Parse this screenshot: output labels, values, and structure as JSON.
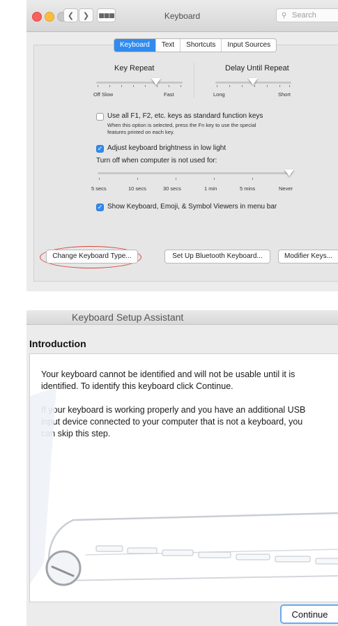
{
  "keyboard_window": {
    "title": "Keyboard",
    "search_placeholder": "Search",
    "tabs": [
      "Keyboard",
      "Text",
      "Shortcuts",
      "Input Sources"
    ],
    "active_tab": "Keyboard",
    "key_repeat": {
      "label": "Key Repeat",
      "min_label": "Off Slow",
      "max_label": "Fast",
      "level": 0.72
    },
    "delay_until_repeat": {
      "label": "Delay Until Repeat",
      "min_label": "Long",
      "max_label": "Short",
      "level": 0.5
    },
    "function_keys": {
      "label": "Use all F1, F2, etc. keys as standard function keys",
      "checked": false,
      "note_line1": "When this option is selected, press the Fn key to use the special",
      "note_line2": "features printed on each key."
    },
    "brightness": {
      "label": "Adjust keyboard brightness in low light",
      "checked": true
    },
    "turn_off": {
      "label": "Turn off when computer is not used for:",
      "ticks": [
        "5 secs",
        "10 secs",
        "30 secs",
        "1 min",
        "5 mins",
        "Never"
      ],
      "selected": "Never"
    },
    "viewers": {
      "label": "Show Keyboard, Emoji, & Symbol Viewers in menu bar",
      "checked": true
    },
    "buttons": {
      "change_type": "Change Keyboard Type...",
      "bluetooth": "Set Up Bluetooth Keyboard...",
      "modifier": "Modifier Keys..."
    }
  },
  "setup_assistant": {
    "title": "Keyboard Setup Assistant",
    "heading": "Introduction",
    "para1_line1": "Your keyboard cannot be identified and will not be usable until it is",
    "para1_line2": "identified. To identify this keyboard click Continue.",
    "para2_line1": "If your keyboard is working properly and you have an additional USB",
    "para2_line2": "input device connected to your computer that is not a keyboard, you",
    "para2_line3": "can skip this step.",
    "continue_label": "Continue"
  },
  "colors": {
    "accent": "#2f8bf0",
    "highlight_ellipse": "#d4453e"
  }
}
